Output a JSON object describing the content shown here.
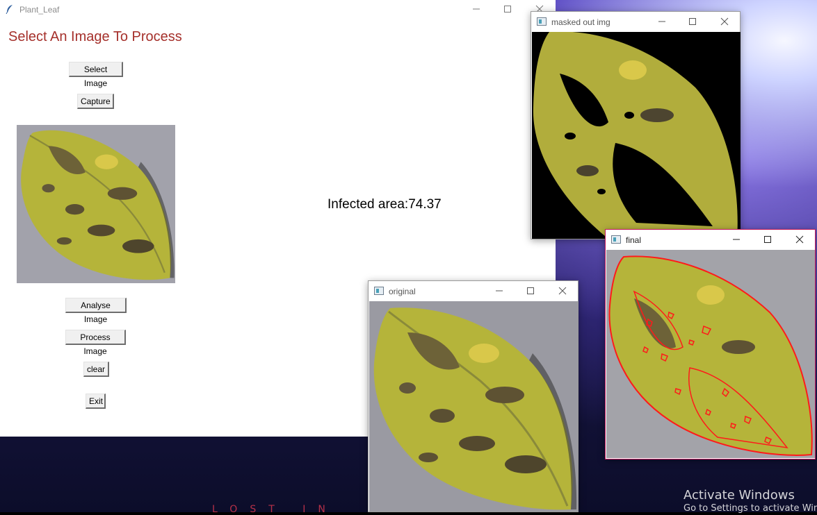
{
  "main_window": {
    "title": "Plant_Leaf",
    "heading": "Select An Image To Process",
    "buttons": {
      "select_image": "Select Image",
      "capture": "Capture",
      "analyse_image": "Analyse Image",
      "process_image": "Process Image",
      "clear": "clear",
      "exit": "Exit"
    },
    "infected_label": "Infected area:74.37"
  },
  "cv_windows": {
    "masked": {
      "title": "masked out img"
    },
    "final": {
      "title": "final"
    },
    "original": {
      "title": "original"
    }
  },
  "desktop": {
    "wallpaper_text": "LOST IN",
    "activate_title": "Activate Windows",
    "activate_sub": "Go to Settings to activate Windows."
  },
  "colors": {
    "heading": "#a5302b",
    "contour": "#ff1a1a",
    "active_border": "#c2185b"
  }
}
